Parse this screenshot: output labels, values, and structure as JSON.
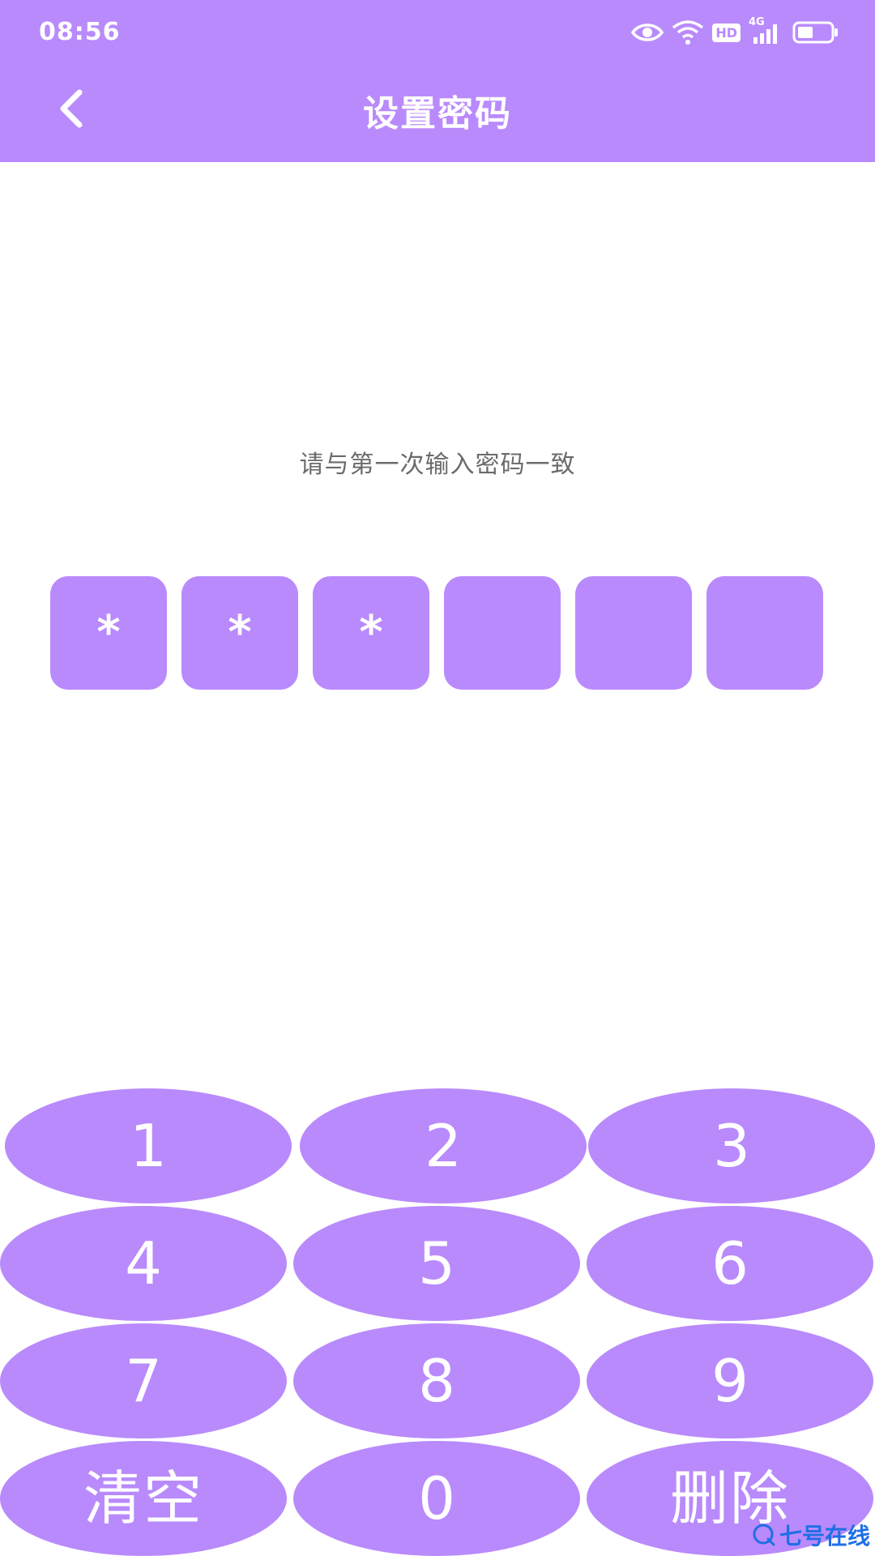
{
  "status_bar": {
    "time": "08:56",
    "network_label": "4G",
    "hd_label": "HD",
    "icons": [
      "eye-icon",
      "wifi-icon",
      "hd-icon",
      "cellular-signal-icon",
      "battery-icon"
    ]
  },
  "header": {
    "title": "设置密码",
    "back_icon": "chevron-left-icon"
  },
  "prompt": "请与第一次输入密码一致",
  "pin": {
    "length": 6,
    "mask_char": "*",
    "slots": [
      "*",
      "*",
      "*",
      "",
      "",
      ""
    ]
  },
  "keypad": {
    "keys": [
      "1",
      "2",
      "3",
      "4",
      "5",
      "6",
      "7",
      "8",
      "9",
      "清空",
      "0",
      "删除"
    ]
  },
  "watermark": {
    "text": "七号在线"
  },
  "colors": {
    "accent": "#b98afc",
    "text_on_accent": "#ffffff",
    "prompt_text": "#6b6b6b",
    "watermark": "#1f6fe5"
  }
}
